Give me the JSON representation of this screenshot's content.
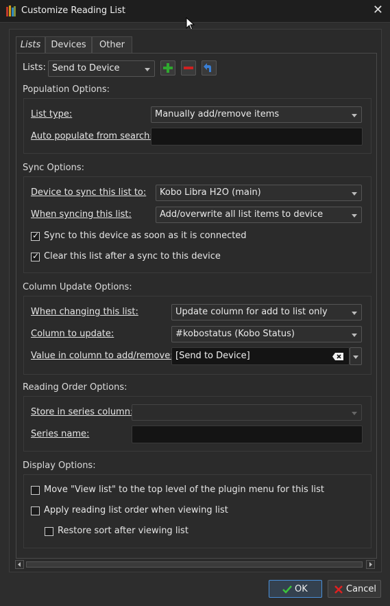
{
  "window": {
    "title": "Customize Reading List"
  },
  "tabs": [
    "Lists",
    "Devices",
    "Other"
  ],
  "lists_row": {
    "label": "Lists:",
    "selected": "Send to Device"
  },
  "population": {
    "title": "Population Options:",
    "list_type_label": "List type:",
    "list_type_value": "Manually add/remove items",
    "auto_label": "Auto populate from search:",
    "auto_value": ""
  },
  "sync": {
    "title": "Sync Options:",
    "device_label": "Device to sync this list to:",
    "device_value": "Kobo Libra H2O (main)",
    "when_label": "When syncing this list:",
    "when_value": "Add/overwrite all list items to device",
    "chk1_label": "Sync to this device as soon as it is connected",
    "chk1_checked": true,
    "chk2_label": "Clear this list after a sync to this device",
    "chk2_checked": true
  },
  "column": {
    "title": "Column Update Options:",
    "changing_label": "When changing this list:",
    "changing_value": "Update column for add to list only",
    "col_label": "Column to update:",
    "col_value": "#kobostatus (Kobo Status)",
    "value_label": "Value in column to add/remove:",
    "value_value": "[Send to Device]"
  },
  "reading": {
    "title": "Reading Order Options:",
    "store_label": "Store in series column:",
    "store_value": "",
    "series_label": "Series name:",
    "series_value": ""
  },
  "display": {
    "title": "Display Options:",
    "chk1_label": "Move \"View list\" to the top level of the plugin menu for this list",
    "chk1_checked": false,
    "chk2_label": "Apply reading list order when viewing list",
    "chk2_checked": false,
    "chk3_label": "Restore sort after viewing list",
    "chk3_checked": false
  },
  "buttons": {
    "ok": "OK",
    "cancel": "Cancel"
  },
  "colors": {
    "add_green": "#2fa82f",
    "remove_red": "#d02020",
    "undo_blue": "#3a7fd5"
  }
}
